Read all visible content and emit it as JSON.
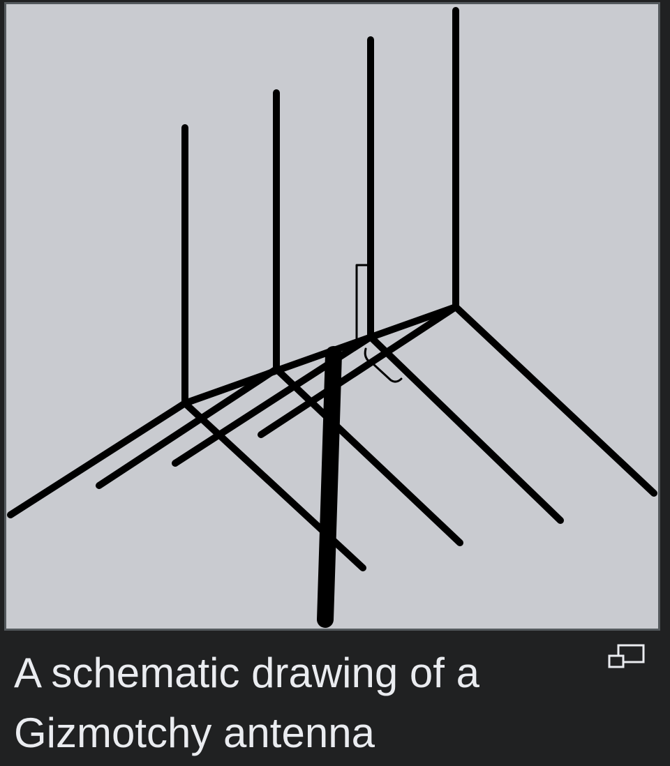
{
  "figure": {
    "caption": "A schematic drawing of a Gizmotchy antenna",
    "enlarge_icon": "magnify-clip-icon",
    "colors": {
      "page_background": "#202122",
      "image_background": "#c9cbd0",
      "image_border": "#54595d",
      "caption_text": "#eaecf0",
      "drawing_stroke": "#000000"
    }
  }
}
